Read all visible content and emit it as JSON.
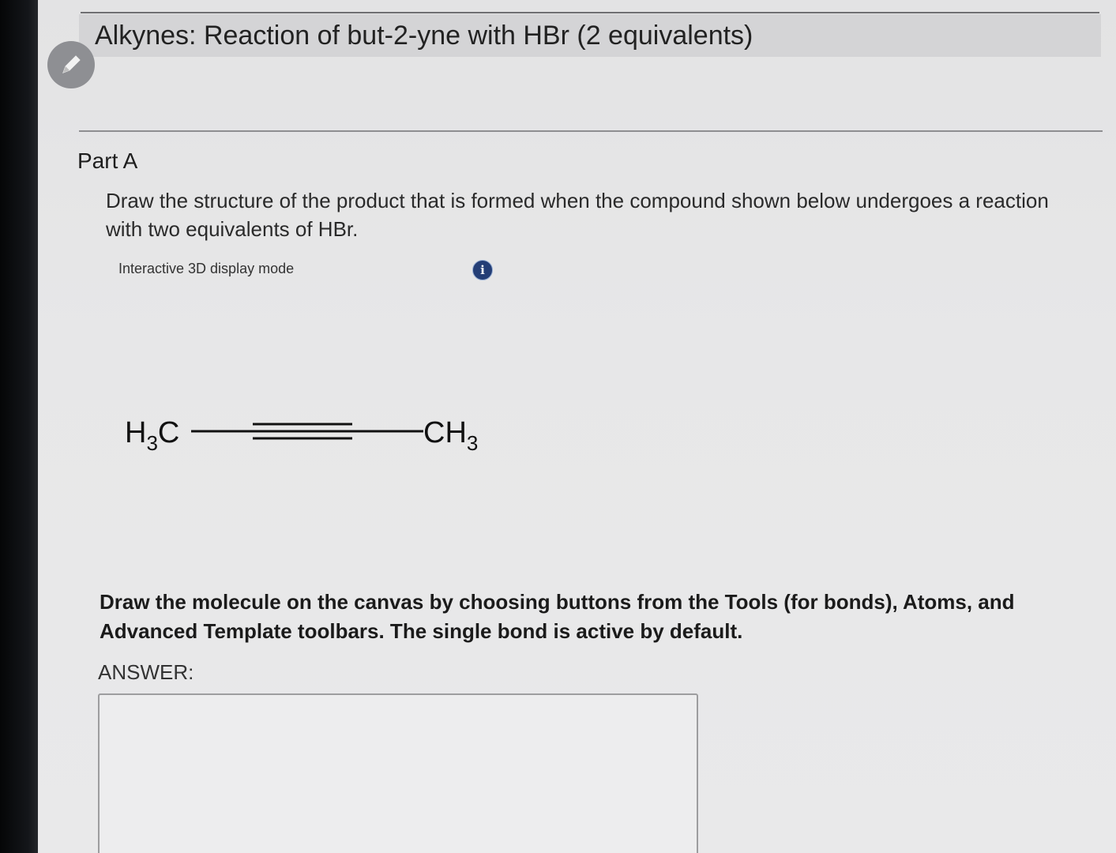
{
  "page": {
    "title": "Alkynes: Reaction of but-2-yne with HBr (2 equivalents)"
  },
  "part": {
    "label": "Part A",
    "question": "Draw the structure of the product that is formed when the compound shown below undergoes a reaction with two equivalents of HBr."
  },
  "viewer": {
    "display_mode_label": "Interactive 3D display mode",
    "info_icon": "info-icon",
    "info_glyph": "i"
  },
  "molecule": {
    "name_icon": "but-2-yne-structure",
    "left_group": "H3C",
    "right_group": "CH3",
    "bond": "triple"
  },
  "instructions": {
    "text": "Draw the molecule on the canvas by choosing buttons from the Tools (for bonds), Atoms, and Advanced Template toolbars. The single bond is active by default."
  },
  "answer": {
    "label": "ANSWER:"
  },
  "colors": {
    "page_background": "#e7e7e8",
    "title_bar": "#d4d4d6",
    "info_icon": "#243e76"
  }
}
